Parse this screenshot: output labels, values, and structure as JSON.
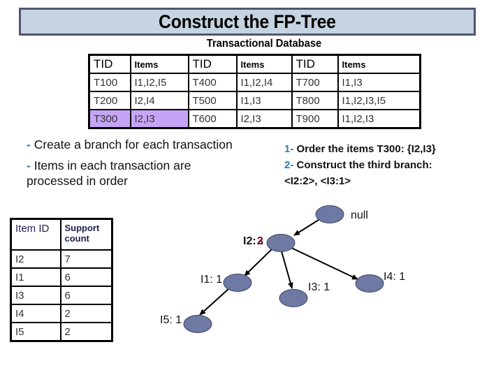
{
  "title": "Construct the FP-Tree",
  "database": {
    "caption": "Transactional Database",
    "headers": [
      "TID",
      "Items",
      "TID",
      "Items",
      "TID",
      "Items"
    ],
    "rows": [
      [
        "T100",
        "I1,I2,I5",
        "T400",
        "I1,I2,I4",
        "T700",
        "I1,I3"
      ],
      [
        "T200",
        "I2,I4",
        "T500",
        "I1,I3",
        "T800",
        "I1,I2,I3,I5"
      ],
      [
        "T300",
        "I2,I3",
        "T600",
        "I2,I3",
        "T900",
        "I1,I2,I3"
      ]
    ],
    "highlighted_transaction": "T300",
    "highlight_color": "#c5a4f5"
  },
  "notes": [
    {
      "bullet": "-",
      "text": "Create a branch for each transaction"
    },
    {
      "bullet": "-",
      "text": "Items in each transaction are processed in order"
    }
  ],
  "steps": [
    {
      "num": "1-",
      "text": "Order the items T300: {I2,I3}"
    },
    {
      "num": "2-",
      "text": "Construct the third branch:"
    },
    {
      "num": "",
      "text": "<I2:2>, <I3:1>"
    }
  ],
  "support_table": {
    "headers": [
      "Item ID",
      "Support count"
    ],
    "rows": [
      [
        "I2",
        "7"
      ],
      [
        "I1",
        "6"
      ],
      [
        "I3",
        "6"
      ],
      [
        "I4",
        "2"
      ],
      [
        "I5",
        "2"
      ]
    ]
  },
  "tree": {
    "root": {
      "label": "null"
    },
    "nodes": [
      {
        "id": "I2",
        "item": "I2",
        "prev_count": "2",
        "count": "3",
        "parent": "null"
      },
      {
        "id": "I1",
        "item": "I1",
        "count": "1",
        "parent": "I2"
      },
      {
        "id": "I3",
        "item": "I3",
        "count": "1",
        "parent": "I2"
      },
      {
        "id": "I4",
        "item": "I4",
        "count": "1",
        "parent": "I2"
      },
      {
        "id": "I5",
        "item": "I5",
        "count": "1",
        "parent": "I1"
      }
    ],
    "labels": {
      "I2_prefix": "I2:",
      "I2_old": "2",
      "I2_new": "3",
      "I1": "I1: 1",
      "I3": "I3: 1",
      "I4": "I4: 1",
      "I5": "I5: 1"
    },
    "node_color": "#6e7aa3",
    "updated_count_color": "#8b1a2b"
  },
  "colors": {
    "title_band_fill": "#c6d4e2",
    "title_band_border": "#4f5670",
    "accent_blue": "#2b7bb9"
  }
}
